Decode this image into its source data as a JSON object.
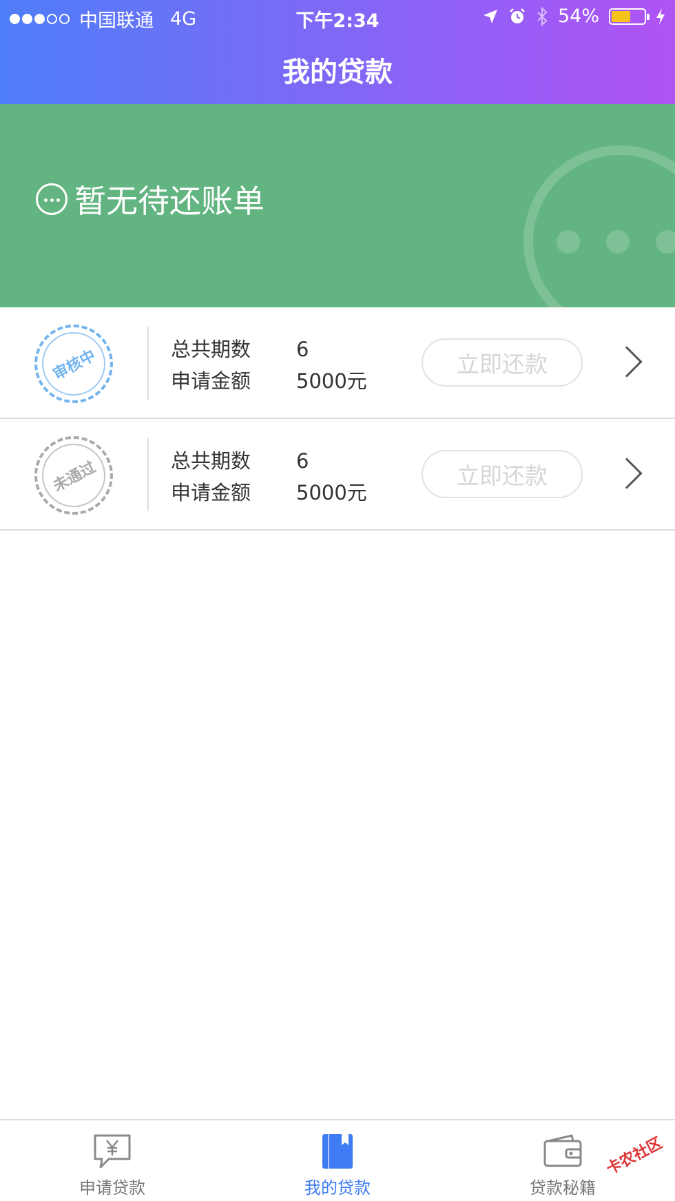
{
  "status_bar": {
    "carrier": "中国联通",
    "network": "4G",
    "time": "下午2:34",
    "battery": "54%",
    "battery_level": 0.54,
    "battery_color": "#f6c31a",
    "icons": [
      "location-arrow-icon",
      "alarm-icon",
      "bluetooth-icon",
      "charging-icon"
    ]
  },
  "header": {
    "title": "我的贷款",
    "gradient": [
      "#4f7ef8",
      "#b053f5"
    ]
  },
  "banner": {
    "message": "暂无待还账单",
    "icon": "ellipsis-circle-icon",
    "color": "#62b480"
  },
  "loans": [
    {
      "status": "审核中",
      "status_color": "#74b4ee",
      "periods_label": "总共期数",
      "periods": "6",
      "amount_label": "申请金额",
      "amount": "5000元",
      "action": "立即还款"
    },
    {
      "status": "未通过",
      "status_color": "#a9a9a9",
      "periods_label": "总共期数",
      "periods": "6",
      "amount_label": "申请金额",
      "amount": "5000元",
      "action": "立即还款"
    }
  ],
  "tabbar": {
    "active_color": "#3f7cf3",
    "tabs": [
      {
        "label": "申请贷款",
        "icon": "yen-chat-icon",
        "active": false
      },
      {
        "label": "我的贷款",
        "icon": "book-icon",
        "active": true
      },
      {
        "label": "贷款秘籍",
        "icon": "wallet-icon",
        "active": false
      }
    ]
  },
  "watermark": "卡农社区"
}
